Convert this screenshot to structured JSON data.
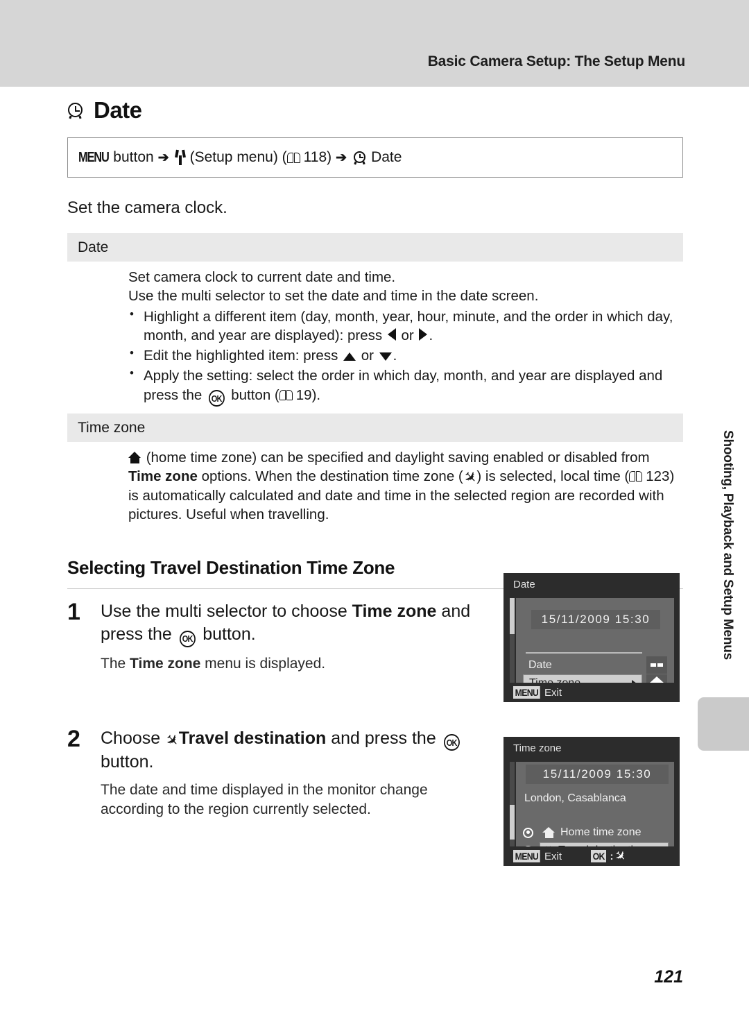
{
  "header": {
    "running_title": "Basic Camera Setup: The Setup Menu"
  },
  "section": {
    "icon": "clock-icon",
    "title": "Date"
  },
  "nav_path": {
    "menu_badge": "MENU",
    "button_word": "button",
    "arrow1": "➔",
    "wrench_icon": "wrench-icon",
    "setup_menu": "(Setup menu)",
    "book_icon": "book-icon",
    "page_ref": "118",
    "arrow2": "➔",
    "clock_icon": "clock-icon",
    "target": "Date"
  },
  "lead_text": "Set the camera clock.",
  "spec_table": [
    {
      "header": "Date",
      "lines": [
        "Set camera clock to current date and time.",
        "Use the multi selector to set the date and time in the date screen."
      ],
      "bullets": [
        {
          "text_before": "Highlight a different item (day, month, year, hour, minute, and the order in which day, month, and year are displayed): press ",
          "glyph1": "left-triangle-icon",
          "mid": " or ",
          "glyph2": "right-triangle-icon",
          "text_after": "."
        },
        {
          "text_before": "Edit the highlighted item: press ",
          "glyph1": "up-triangle-icon",
          "mid": " or ",
          "glyph2": "down-triangle-icon",
          "text_after": "."
        },
        {
          "text_before": "Apply the setting: select the order in which day, month, and year are displayed and press the ",
          "glyph1": "ok-button-icon",
          "mid": " button (",
          "glyph2": "book-icon",
          "page_ref": "19",
          "text_after": ")."
        }
      ]
    },
    {
      "header": "Time zone",
      "paragraph_parts": {
        "p1": " (home time zone) can be specified and daylight saving enabled or disabled from ",
        "bold1": "Time zone",
        "p2": " options. When the destination time zone (",
        "p3": ") is selected, local time (",
        "page_ref": "123",
        "p4": ") is automatically calculated and date and time in the selected region are recorded with pictures. Useful when travelling."
      }
    }
  ],
  "sub_heading": "Selecting Travel Destination Time Zone",
  "steps": [
    {
      "number": "1",
      "title_parts": {
        "a": "Use the multi selector to choose ",
        "bold": "Time zone",
        "b": " and press the ",
        "ok": "ok-button-icon",
        "c": " button."
      },
      "desc_parts": {
        "a": "The ",
        "bold": "Time zone",
        "b": " menu is displayed."
      }
    },
    {
      "number": "2",
      "title_parts": {
        "a": "Choose ",
        "plane": "airplane-icon",
        "bold": "Travel destination",
        "b": " and press the ",
        "ok": "ok-button-icon",
        "c": " button."
      },
      "desc": "The date and time displayed in the monitor change according to the region currently selected."
    }
  ],
  "screens": [
    {
      "title": "Date",
      "datetime": "15/11/2009  15:30",
      "rows": [
        {
          "label": "Date",
          "selected": false,
          "side_icon": "dash-icon"
        },
        {
          "label": "Time zone",
          "selected": true,
          "side_icon": "home-icon"
        }
      ],
      "bottom": {
        "key": "MENU",
        "label": "Exit"
      }
    },
    {
      "title": "Time zone",
      "datetime": "15/11/2009  15:30",
      "region": "London, Casablanca",
      "options": [
        {
          "icon": "home-icon",
          "label": "Home time zone",
          "radio_selected": true,
          "row_highlighted": false
        },
        {
          "icon": "airplane-icon",
          "label": "Travel destination",
          "radio_selected": false,
          "row_highlighted": true
        }
      ],
      "bottom": {
        "key": "MENU",
        "label": "Exit",
        "ok_key": "OK",
        "ok_separator": ":",
        "ok_icon": "airplane-icon"
      }
    }
  ],
  "side_tab": {
    "text": "Shooting, Playback and Setup Menus"
  },
  "page_number": "121"
}
